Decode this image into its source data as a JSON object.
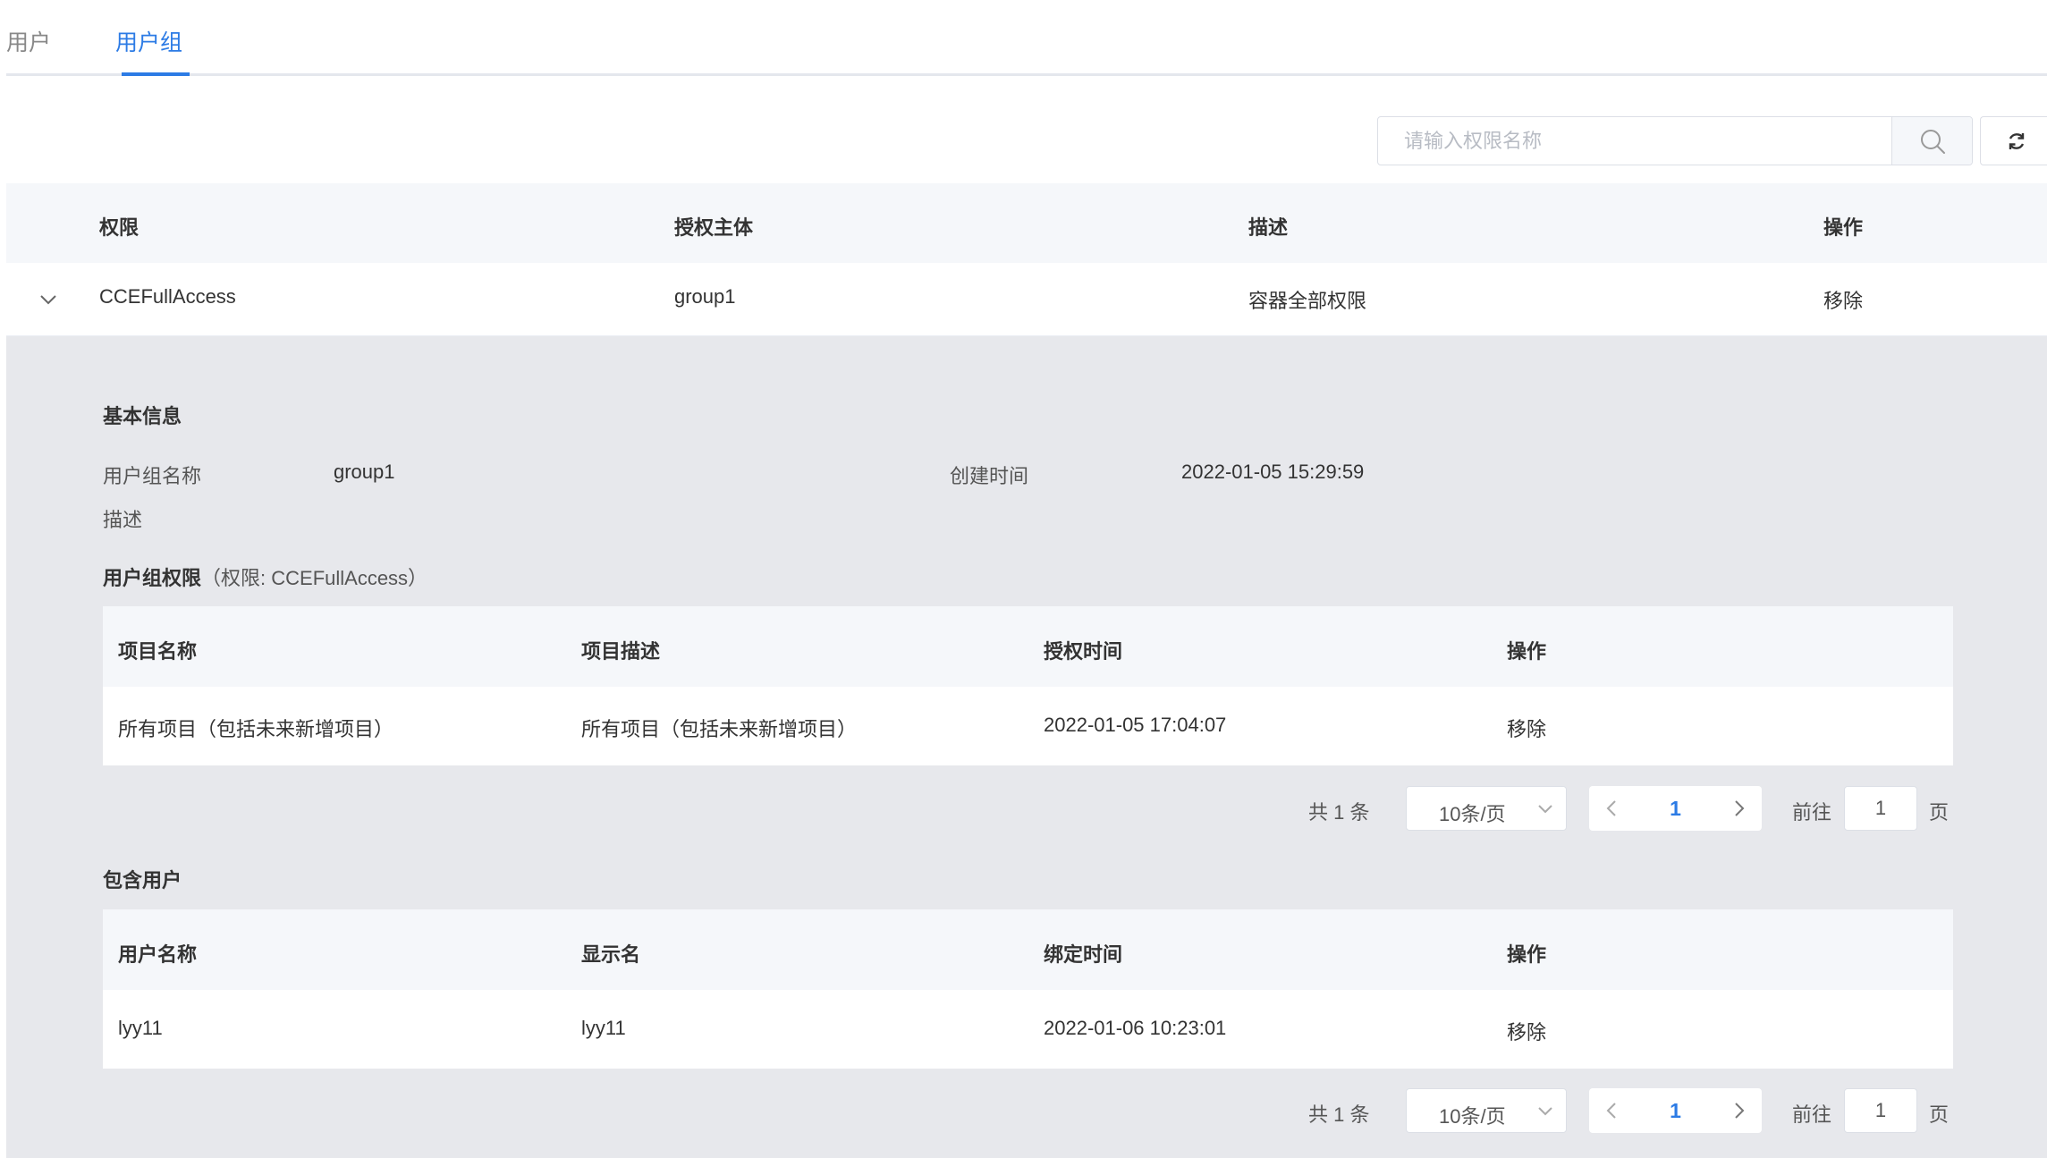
{
  "tabs": [
    {
      "label": "用户",
      "active": false
    },
    {
      "label": "用户组",
      "active": true
    }
  ],
  "toolbar": {
    "search_placeholder": "请输入权限名称",
    "search_value": "",
    "search_icon": "search-icon",
    "refresh_icon": "refresh-icon"
  },
  "main_table": {
    "headers": [
      "权限",
      "授权主体",
      "描述",
      "操作"
    ],
    "rows": [
      {
        "permission": "CCEFullAccess",
        "principal": "group1",
        "description": "容器全部权限",
        "action": "移除",
        "expanded": true
      }
    ]
  },
  "detail": {
    "basic_title": "基本信息",
    "group_name_label": "用户组名称",
    "group_name_value": "group1",
    "created_label": "创建时间",
    "created_value": "2022-01-05 15:29:59",
    "desc_label": "描述",
    "desc_value": "",
    "group_perm_title": "用户组权限",
    "group_perm_note": "（权限: CCEFullAccess）",
    "perm_table": {
      "headers": [
        "项目名称",
        "项目描述",
        "授权时间",
        "操作"
      ],
      "rows": [
        {
          "name": "所有项目（包括未来新增项目）",
          "desc": "所有项目（包括未来新增项目）",
          "time": "2022-01-05 17:04:07",
          "action": "移除"
        }
      ]
    },
    "perm_pager": {
      "total": "共 1 条",
      "page_size": "10条/页",
      "current": "1",
      "goto_label": "前往",
      "goto_value": "1",
      "page_unit": "页"
    },
    "users_title": "包含用户",
    "user_table": {
      "headers": [
        "用户名称",
        "显示名",
        "绑定时间",
        "操作"
      ],
      "rows": [
        {
          "name": "lyy11",
          "display": "lyy11",
          "time": "2022-01-06 10:23:01",
          "action": "移除"
        }
      ]
    },
    "user_pager": {
      "total": "共 1 条",
      "page_size": "10条/页",
      "current": "1",
      "goto_label": "前往",
      "goto_value": "1",
      "page_unit": "页"
    }
  },
  "colors": {
    "accent": "#2c7be5",
    "panel_bg": "#e7e8ec",
    "header_bg": "#f5f7fa"
  }
}
